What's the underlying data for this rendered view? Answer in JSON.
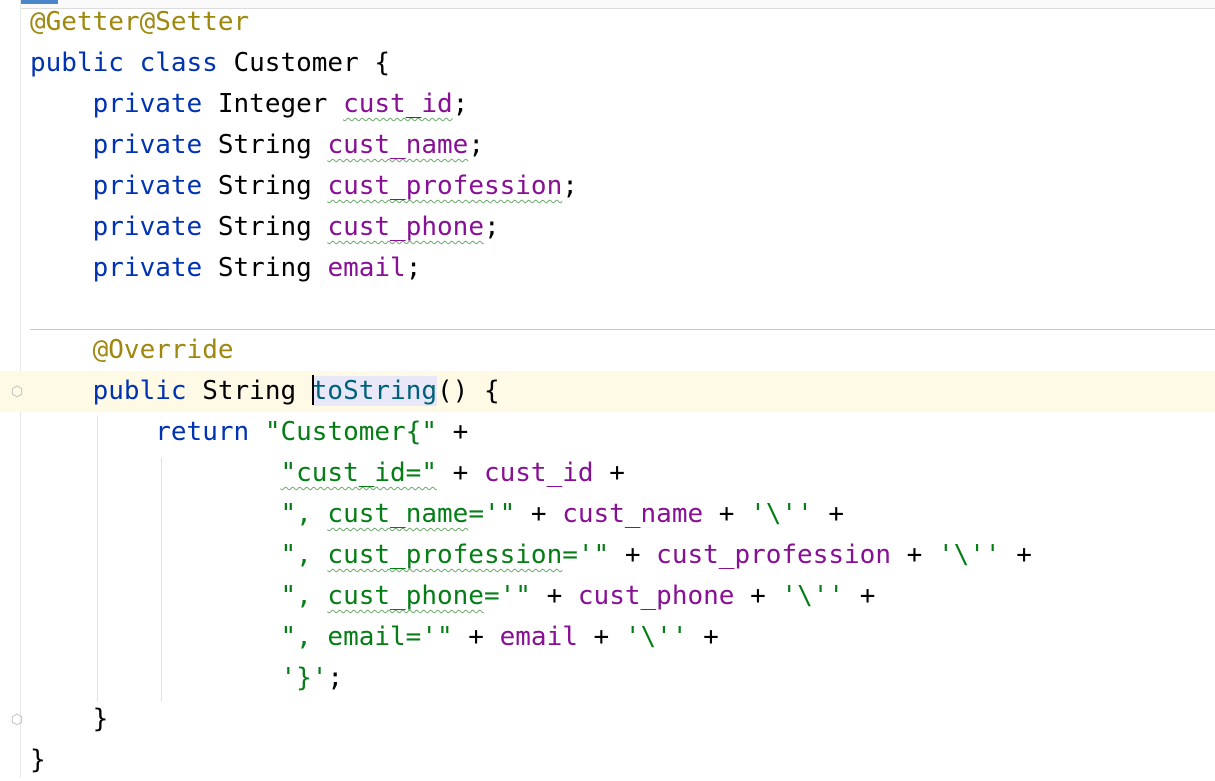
{
  "editor": {
    "lines": [
      [
        [
          "ann",
          "@Getter@Setter"
        ]
      ],
      [
        [
          "kw",
          "public class "
        ],
        [
          "plain",
          "Customer {"
        ]
      ],
      [
        [
          "plain",
          "    "
        ],
        [
          "kw",
          "private "
        ],
        [
          "plain",
          "Integer "
        ],
        [
          "fld wavy",
          "cust_id"
        ],
        [
          "plain",
          ";"
        ]
      ],
      [
        [
          "plain",
          "    "
        ],
        [
          "kw",
          "private "
        ],
        [
          "plain",
          "String "
        ],
        [
          "fld wavy",
          "cust_name"
        ],
        [
          "plain",
          ";"
        ]
      ],
      [
        [
          "plain",
          "    "
        ],
        [
          "kw",
          "private "
        ],
        [
          "plain",
          "String "
        ],
        [
          "fld wavy",
          "cust_profession"
        ],
        [
          "plain",
          ";"
        ]
      ],
      [
        [
          "plain",
          "    "
        ],
        [
          "kw",
          "private "
        ],
        [
          "plain",
          "String "
        ],
        [
          "fld wavy",
          "cust_phone"
        ],
        [
          "plain",
          ";"
        ]
      ],
      [
        [
          "plain",
          "    "
        ],
        [
          "kw",
          "private "
        ],
        [
          "plain",
          "String "
        ],
        [
          "fld",
          "email"
        ],
        [
          "plain",
          ";"
        ]
      ],
      [],
      [
        [
          "plain",
          "    "
        ],
        [
          "ann",
          "@Override"
        ]
      ],
      [
        [
          "plain",
          "    "
        ],
        [
          "kw",
          "public "
        ],
        [
          "plain",
          "String "
        ],
        [
          "caret",
          ""
        ],
        [
          "mth hl",
          "toString"
        ],
        [
          "plain",
          "() {"
        ]
      ],
      [
        [
          "plain",
          "        "
        ],
        [
          "kw",
          "return "
        ],
        [
          "str",
          "\"Customer{\""
        ],
        [
          "plain",
          " +"
        ]
      ],
      [
        [
          "plain",
          "                "
        ],
        [
          "str wavy",
          "\"cust_id=\""
        ],
        [
          "plain",
          " + "
        ],
        [
          "fld",
          "cust_id"
        ],
        [
          "plain",
          " +"
        ]
      ],
      [
        [
          "plain",
          "                "
        ],
        [
          "str",
          "\", "
        ],
        [
          "str wavy",
          "cust_name"
        ],
        [
          "str",
          "='\""
        ],
        [
          "plain",
          " + "
        ],
        [
          "fld",
          "cust_name"
        ],
        [
          "plain",
          " + "
        ],
        [
          "str",
          "'\\''"
        ],
        [
          "plain",
          " +"
        ]
      ],
      [
        [
          "plain",
          "                "
        ],
        [
          "str",
          "\", "
        ],
        [
          "str wavy",
          "cust_profession"
        ],
        [
          "str",
          "='\""
        ],
        [
          "plain",
          " + "
        ],
        [
          "fld",
          "cust_profession"
        ],
        [
          "plain",
          " + "
        ],
        [
          "str",
          "'\\''"
        ],
        [
          "plain",
          " +"
        ]
      ],
      [
        [
          "plain",
          "                "
        ],
        [
          "str",
          "\", "
        ],
        [
          "str wavy",
          "cust_phone"
        ],
        [
          "str",
          "='\""
        ],
        [
          "plain",
          " + "
        ],
        [
          "fld",
          "cust_phone"
        ],
        [
          "plain",
          " + "
        ],
        [
          "str",
          "'\\''"
        ],
        [
          "plain",
          " +"
        ]
      ],
      [
        [
          "plain",
          "                "
        ],
        [
          "str",
          "\", email='\""
        ],
        [
          "plain",
          " + "
        ],
        [
          "fld",
          "email"
        ],
        [
          "plain",
          " + "
        ],
        [
          "str",
          "'\\''"
        ],
        [
          "plain",
          " +"
        ]
      ],
      [
        [
          "plain",
          "                "
        ],
        [
          "str",
          "'}'"
        ],
        [
          "plain",
          ";"
        ]
      ],
      [
        [
          "plain",
          "    }"
        ]
      ],
      [
        [
          "plain",
          "}"
        ]
      ]
    ],
    "current_line_index": 9,
    "fold_marker_lines": [
      9,
      17
    ],
    "fold_icon": "fold-icon",
    "colors": {
      "keyword": "#0033b3",
      "annotation": "#9e880d",
      "field": "#871094",
      "string": "#067d17",
      "method": "#00627a",
      "current_line_bg": "#fefae6"
    }
  }
}
